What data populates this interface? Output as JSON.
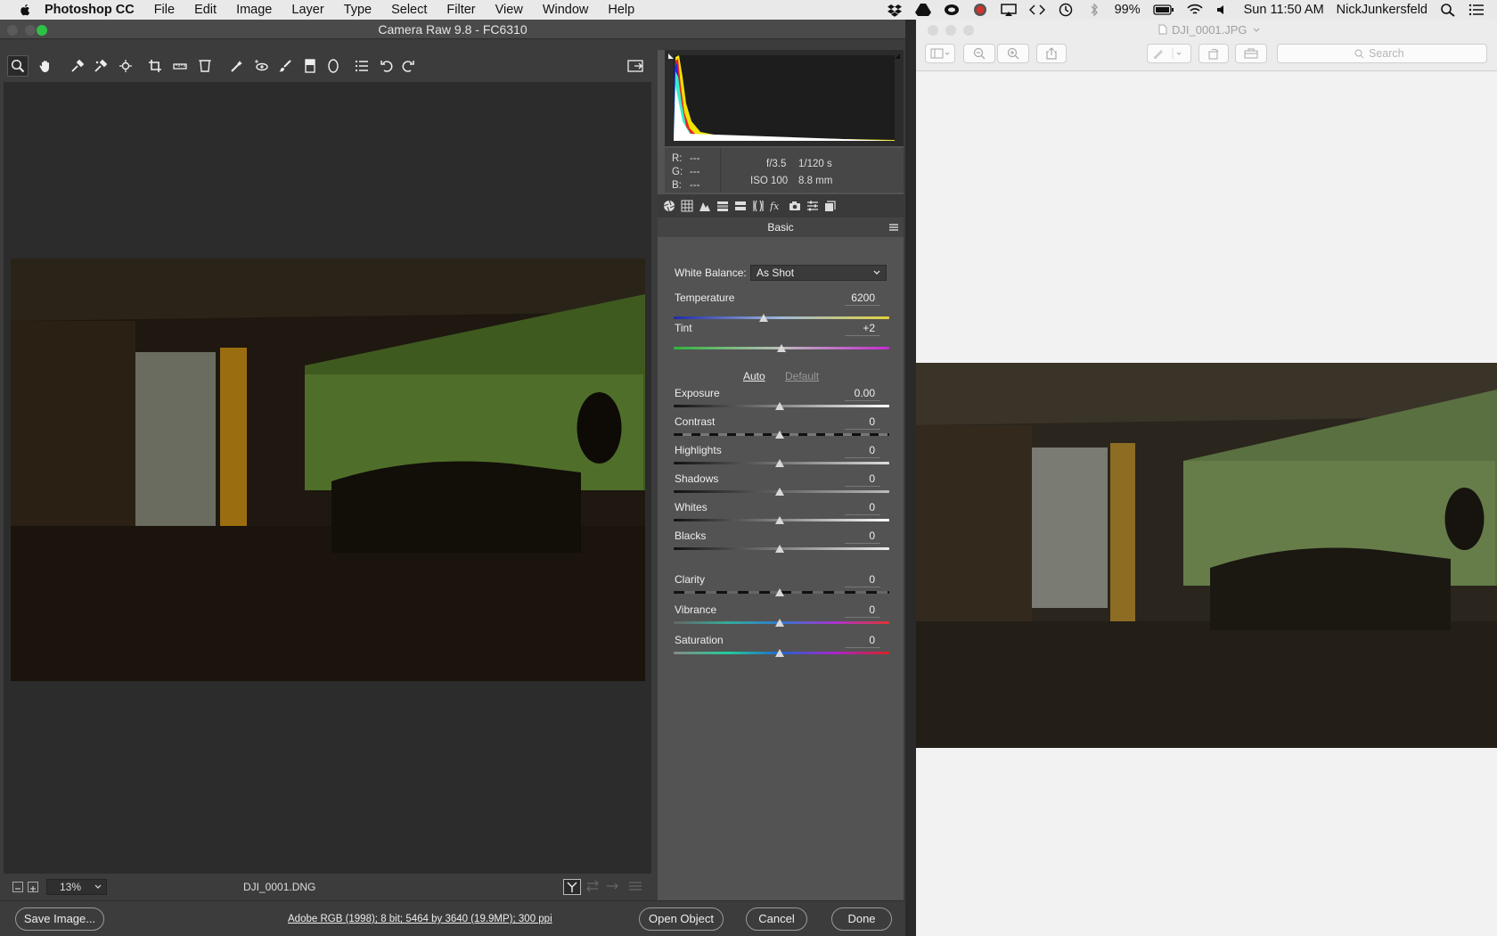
{
  "menubar": {
    "app_name": "Photoshop CC",
    "menus": [
      "File",
      "Edit",
      "Image",
      "Layer",
      "Type",
      "Select",
      "Filter",
      "View",
      "Window",
      "Help"
    ],
    "battery": "99%",
    "clock": "Sun 11:50 AM",
    "user": "NickJunkersfeld"
  },
  "camera_raw": {
    "title": "Camera Raw 9.8  -  FC6310",
    "exif": {
      "r_label": "R:",
      "g_label": "G:",
      "b_label": "B:",
      "r_value": "---",
      "g_value": "---",
      "b_value": "---",
      "aperture": "f/3.5",
      "shutter": "1/120 s",
      "iso": "ISO 100",
      "focal": "8.8 mm"
    },
    "panel_title": "Basic",
    "white_balance_label": "White Balance:",
    "white_balance_value": "As Shot",
    "temperature_label": "Temperature",
    "temperature_value": "6200",
    "tint_label": "Tint",
    "tint_value": "+2",
    "auto_label": "Auto",
    "default_label": "Default",
    "sliders": [
      {
        "label": "Exposure",
        "value": "0.00"
      },
      {
        "label": "Contrast",
        "value": "0"
      },
      {
        "label": "Highlights",
        "value": "0"
      },
      {
        "label": "Shadows",
        "value": "0"
      },
      {
        "label": "Whites",
        "value": "0"
      },
      {
        "label": "Blacks",
        "value": "0"
      },
      {
        "label": "Clarity",
        "value": "0"
      },
      {
        "label": "Vibrance",
        "value": "0"
      },
      {
        "label": "Saturation",
        "value": "0"
      }
    ],
    "zoom": "13%",
    "filename": "DJI_0001.DNG",
    "workflow": "Adobe RGB (1998); 8 bit; 5464 by 3640 (19.9MP); 300 ppi",
    "buttons": {
      "save_image": "Save Image...",
      "open_object": "Open Object",
      "cancel": "Cancel",
      "done": "Done"
    }
  },
  "preview": {
    "title": "DJI_0001.JPG",
    "search_placeholder": "Search"
  }
}
